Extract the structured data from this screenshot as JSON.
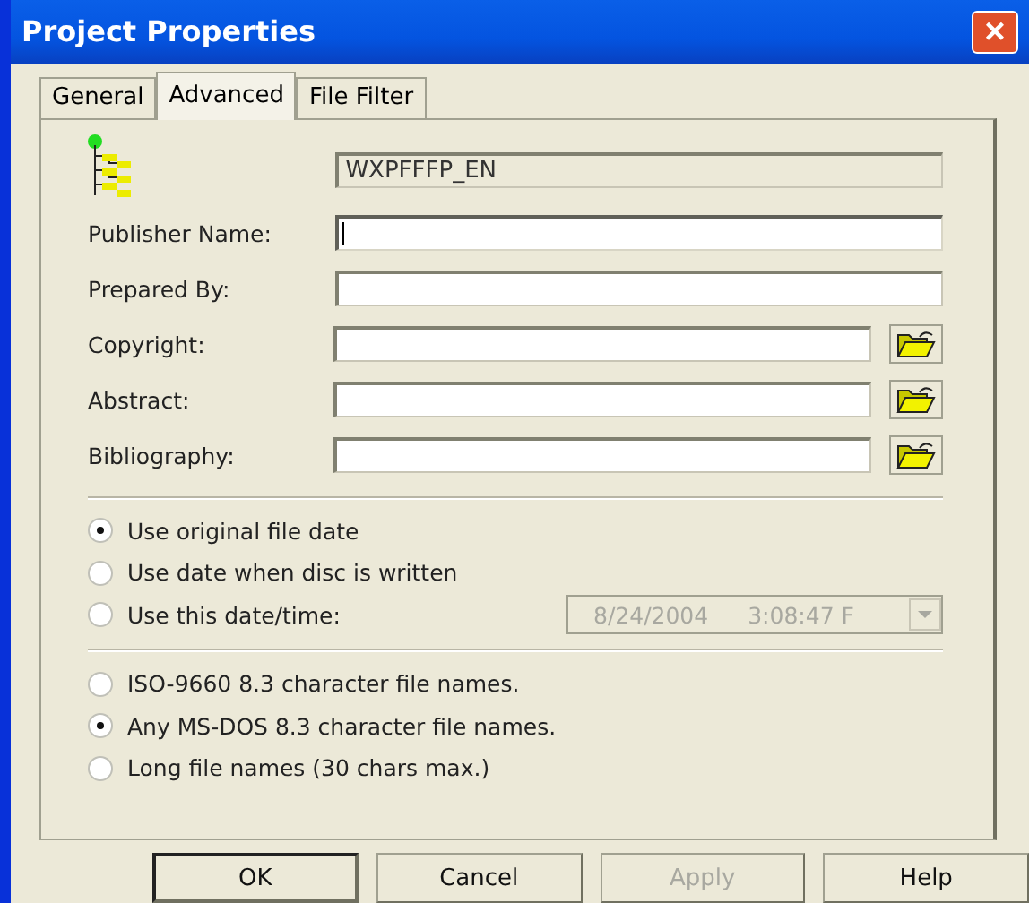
{
  "window": {
    "title": "Project Properties",
    "close": "×"
  },
  "tabs": [
    {
      "label": "General",
      "selected": false
    },
    {
      "label": "Advanced",
      "selected": true
    },
    {
      "label": "File Filter",
      "selected": false
    }
  ],
  "project_name": {
    "value": "WXPFFFP_EN",
    "disabled": true
  },
  "fields": [
    {
      "label": "Publisher Name:",
      "focused": true,
      "browse": false
    },
    {
      "label": "Prepared By:",
      "focused": false,
      "browse": false
    },
    {
      "label": "Copyright:",
      "focused": false,
      "browse": true
    },
    {
      "label": "Abstract:",
      "focused": false,
      "browse": true
    },
    {
      "label": "Bibliography:",
      "focused": false,
      "browse": true
    }
  ],
  "date_options": [
    {
      "label": "Use original file date",
      "selected": true
    },
    {
      "label": "Use date when disc is written",
      "selected": false
    },
    {
      "label": "Use this date/time:",
      "selected": false
    }
  ],
  "date_time": {
    "date": "8/24/2004",
    "time": "3:08:47 F",
    "disabled": true
  },
  "name_options": [
    {
      "label": "ISO-9660 8.3 character file names.",
      "selected": false
    },
    {
      "label": "Any MS-DOS 8.3 character file names.",
      "selected": true
    },
    {
      "label": "Long file names (30 chars max.)",
      "selected": false
    }
  ],
  "buttons": [
    {
      "label": "OK",
      "default": true,
      "disabled": false
    },
    {
      "label": "Cancel",
      "default": false,
      "disabled": false
    },
    {
      "label": "Apply",
      "default": false,
      "disabled": true
    },
    {
      "label": "Help",
      "default": false,
      "disabled": false
    }
  ]
}
